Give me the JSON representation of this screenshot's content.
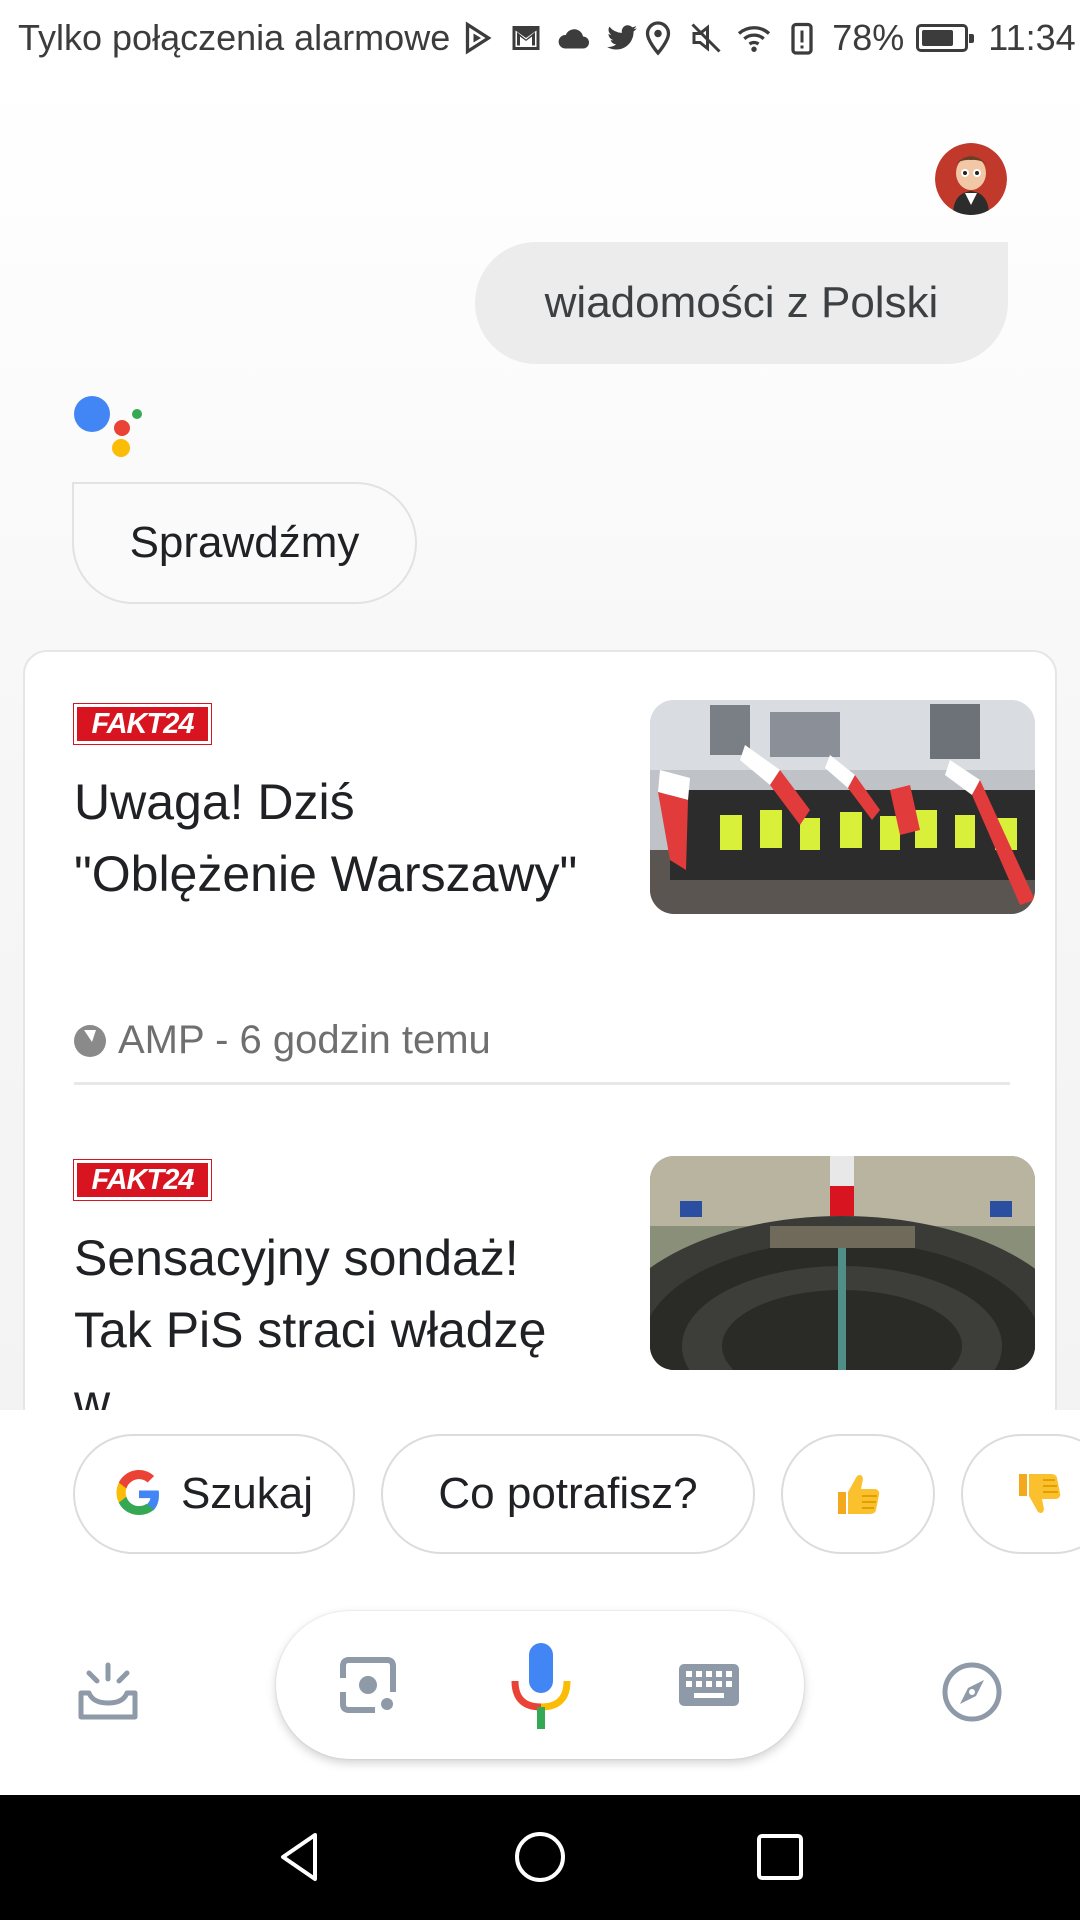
{
  "status_bar": {
    "carrier": "Tylko połączenia alarmowe",
    "battery_percent": "78%",
    "battery_level": 0.78,
    "time": "11:34",
    "notification_icons": [
      "play-store-icon",
      "gmail-icon",
      "cloud-icon",
      "twitter-icon"
    ],
    "system_icons": [
      "location-icon",
      "vibrate-off-icon",
      "wifi-icon",
      "battery-alert-icon",
      "battery-icon"
    ]
  },
  "conversation": {
    "user_query": "wiadomości z Polski",
    "assistant_reply": "Sprawdźmy"
  },
  "news": [
    {
      "source": "FAKT24",
      "headline": "Uwaga! Dziś \"Oblężenie Warszawy\"",
      "meta": "AMP - 6 godzin temu"
    },
    {
      "source": "FAKT24",
      "headline": "Sensacyjny sondaż! Tak PiS straci władzę w"
    }
  ],
  "suggestions": {
    "search_label": "Szukaj",
    "capabilities_label": "Co potrafisz?",
    "thumbs_up": "👍",
    "thumbs_down": "👎"
  },
  "bottom_bar": {
    "icons": [
      "updates-icon",
      "lens-icon",
      "mic-icon",
      "keyboard-icon",
      "explore-icon"
    ]
  },
  "nav_bar": {
    "icons": [
      "back-icon",
      "home-icon",
      "recents-icon"
    ]
  },
  "colors": {
    "google_blue": "#4285F4",
    "google_red": "#EA4335",
    "google_yellow": "#FBBC05",
    "google_green": "#34A853",
    "fakt_red": "#D7141F"
  }
}
